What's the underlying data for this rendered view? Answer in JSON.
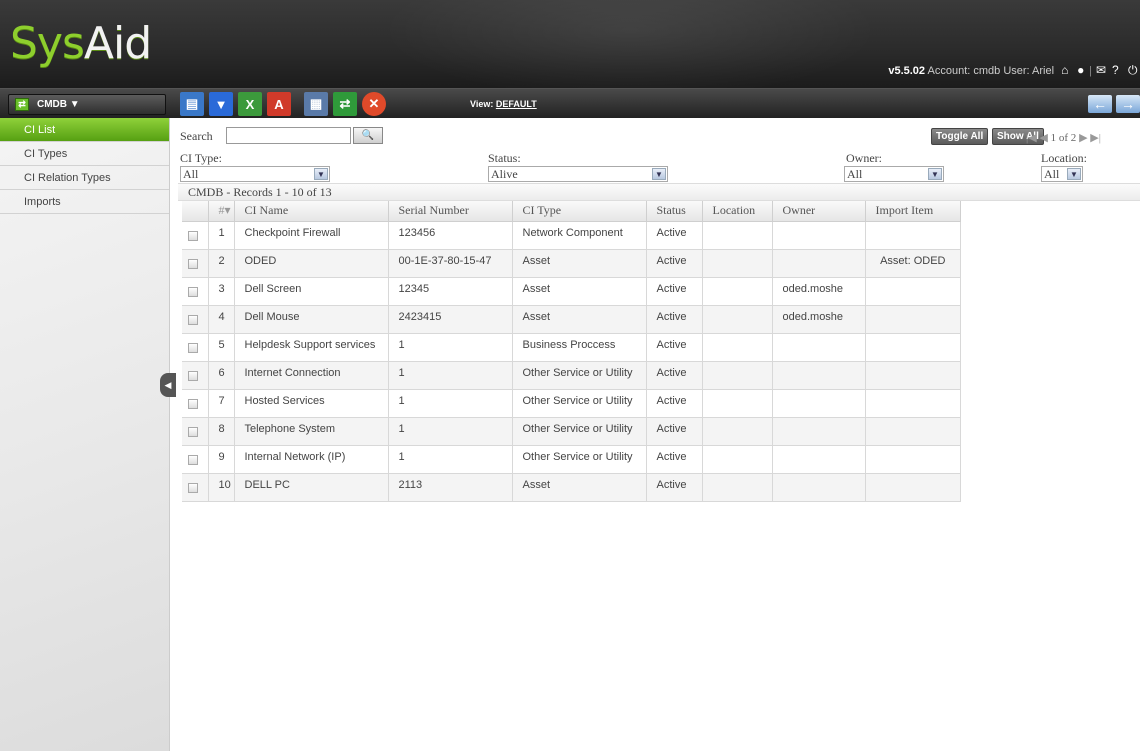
{
  "header": {
    "logo_sys": "Sys",
    "logo_aid": "Aid",
    "version": "v5.5.02",
    "account": "Account: cmdb",
    "user": "User: Ariel"
  },
  "toolbar": {
    "module_label": "CMDB ▼",
    "view_label": "View: ",
    "view_value": "DEFAULT",
    "tools": [
      {
        "name": "new-ci-icon",
        "color": "#3a78c8"
      },
      {
        "name": "filter-icon",
        "color": "#2a6ad8"
      },
      {
        "name": "excel-export-icon",
        "color": "#3c9a3c"
      },
      {
        "name": "pdf-export-icon",
        "color": "#d03a2a"
      },
      {
        "name": "print-icon",
        "color": "#5a7aa8"
      },
      {
        "name": "sync-icon",
        "color": "#2f9a3a"
      },
      {
        "name": "delete-icon",
        "color": "#e04a2a"
      }
    ]
  },
  "sidebar": {
    "items": [
      {
        "label": "CI List",
        "active": true
      },
      {
        "label": "CI Types",
        "active": false
      },
      {
        "label": "CI Relation Types",
        "active": false
      },
      {
        "label": "Imports",
        "active": false
      }
    ]
  },
  "search": {
    "label": "Search",
    "value": "",
    "button": "🔍"
  },
  "actions": {
    "toggle_all": "Toggle All",
    "show_all": "Show All",
    "pager": "1 of 2"
  },
  "filters": {
    "ci_type_label": "CI Type:",
    "ci_type_value": "All",
    "status_label": "Status:",
    "status_value": "Alive",
    "owner_label": "Owner:",
    "owner_value": "All",
    "location_label": "Location:",
    "location_value": "All"
  },
  "records_text": "CMDB - Records 1 - 10 of 13",
  "table": {
    "headers": [
      "",
      "#",
      "CI Name",
      "Serial Number",
      "CI Type",
      "Status",
      "Location",
      "Owner",
      "Import Item"
    ],
    "rows": [
      [
        "1",
        "Checkpoint Firewall",
        "123456",
        "Network Component",
        "Active",
        "",
        "",
        ""
      ],
      [
        "2",
        "ODED",
        "00-1E-37-80-15-47",
        "Asset",
        "Active",
        "",
        "",
        "Asset: ODED"
      ],
      [
        "3",
        "Dell Screen",
        "12345",
        "Asset",
        "Active",
        "",
        "oded.moshe",
        ""
      ],
      [
        "4",
        "Dell Mouse",
        "2423415",
        "Asset",
        "Active",
        "",
        "oded.moshe",
        ""
      ],
      [
        "5",
        "Helpdesk Support services",
        "1",
        "Business Proccess",
        "Active",
        "",
        "",
        ""
      ],
      [
        "6",
        "Internet Connection",
        "1",
        "Other Service or Utility",
        "Active",
        "",
        "",
        ""
      ],
      [
        "7",
        "Hosted Services",
        "1",
        "Other Service or Utility",
        "Active",
        "",
        "",
        ""
      ],
      [
        "8",
        "Telephone System",
        "1",
        "Other Service or Utility",
        "Active",
        "",
        "",
        ""
      ],
      [
        "9",
        "Internal Network (IP)",
        "1",
        "Other Service or Utility",
        "Active",
        "",
        "",
        ""
      ],
      [
        "10",
        "DELL PC",
        "2113",
        "Asset",
        "Active",
        "",
        "",
        ""
      ]
    ]
  }
}
